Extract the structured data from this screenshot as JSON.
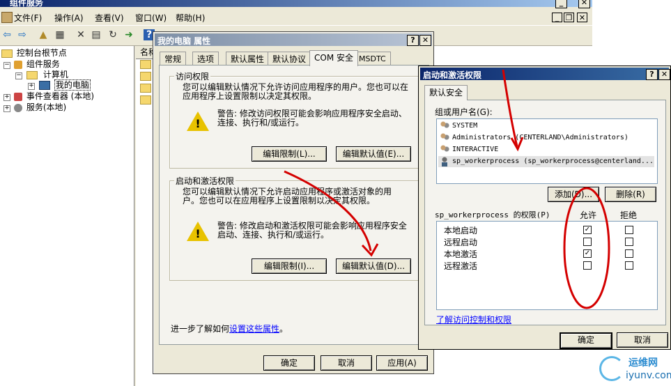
{
  "main_window": {
    "title": "组件服务",
    "menu": [
      "文件(F)",
      "操作(A)",
      "查看(V)",
      "窗口(W)",
      "帮助(H)"
    ]
  },
  "tree": {
    "items": [
      "控制台根节点",
      "组件服务",
      "计算机",
      "我的电脑",
      "事件查看器 (本地)",
      "服务(本地)"
    ]
  },
  "list_header": "名称",
  "props_dialog": {
    "title": "我的电脑 属性",
    "tabs": [
      "常规",
      "选项",
      "默认属性",
      "默认协议",
      "COM 安全",
      "MSDTC"
    ],
    "active_tab": "COM 安全",
    "access": {
      "title": "访问权限",
      "desc": "您可以编辑默认情况下允许访问应用程序的用户。您也可以在应用程序上设置限制以决定其权限。",
      "warning": "警告: 修改访问权限可能会影响应用程序安全启动、连接、执行和/或运行。",
      "edit_limits": "编辑限制(L)...",
      "edit_default": "编辑默认值(E)..."
    },
    "launch": {
      "title": "启动和激活权限",
      "desc": "您可以编辑默认情况下允许启动应用程序或激活对象的用户。您也可以在应用程序上设置限制以决定其权限。",
      "warning": "警告: 修改启动和激活权限可能会影响应用程序安全启动、连接、执行和/或运行。",
      "edit_limits": "编辑限制(I)...",
      "edit_default": "编辑默认值(D)..."
    },
    "more_info_prefix": "进一步了解如何",
    "more_info_link": "设置这些属性",
    "more_info_suffix": "。",
    "ok": "确定",
    "cancel": "取消",
    "apply": "应用(A)"
  },
  "perm_dialog": {
    "title": "启动和激活权限",
    "tab": "默认安全",
    "group_label": "组或用户名(G):",
    "users": [
      "SYSTEM",
      "Administrators (CENTERLAND\\Administrators)",
      "INTERACTIVE",
      "sp_workerprocess (sp_workerprocess@centerland..."
    ],
    "add": "添加(D)...",
    "remove": "删除(R)",
    "perm_label": "sp_workerprocess 的权限(P)",
    "allow": "允许",
    "deny": "拒绝",
    "permissions": [
      {
        "name": "本地启动",
        "allow": true,
        "deny": false
      },
      {
        "name": "远程启动",
        "allow": false,
        "deny": false
      },
      {
        "name": "本地激活",
        "allow": true,
        "deny": false
      },
      {
        "name": "远程激活",
        "allow": false,
        "deny": false
      }
    ],
    "link": "了解访问控制和权限",
    "ok": "确定",
    "cancel": "取消"
  },
  "watermark": {
    "brand": "运维网",
    "url": "iyunv.com"
  },
  "colors": {
    "titlebar": "#0a246a",
    "annotation": "#d40000",
    "face": "#ece9d8"
  }
}
